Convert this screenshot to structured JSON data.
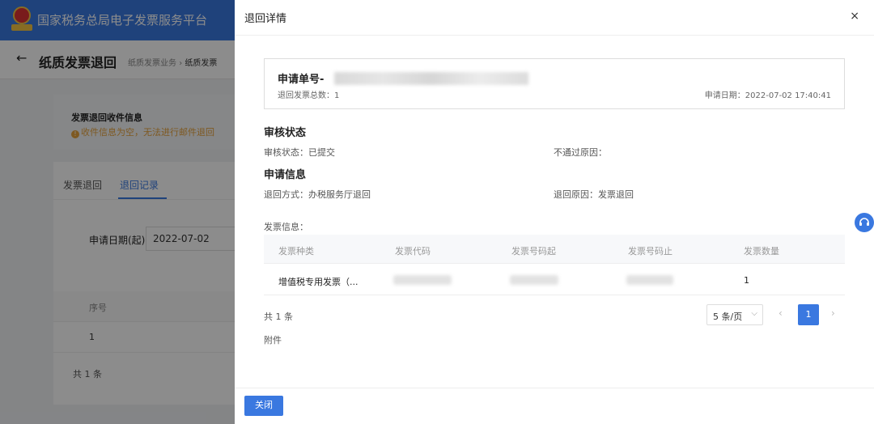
{
  "background": {
    "app_title": "国家税务总局电子发票服务平台",
    "page_title": "纸质发票退回",
    "breadcrumb": [
      "纸质发票业务",
      "纸质发票"
    ],
    "info_card": {
      "heading": "发票退回收件信息",
      "warning": "收件信息为空，无法进行邮件退回"
    },
    "tabs": [
      "发票退回",
      "退回记录"
    ],
    "date_filter": {
      "label": "申请日期(起)",
      "value": "2022-07-02"
    },
    "table": {
      "column": "序号",
      "row_value": "1"
    },
    "total": "共 1 条"
  },
  "drawer": {
    "title": "退回详情",
    "close_glyph": "×",
    "apply_no_label": "申请单号-",
    "apply_total": "退回发票总数：1",
    "apply_date": "申请日期：2022-07-02 17:40:41",
    "review_section": "审核状态",
    "review_status": "审核状态：已提交",
    "reject_reason": "不通过原因：",
    "apply_section": "申请信息",
    "return_method": "退回方式：办税服务厅退回",
    "return_reason": "退回原因：发票退回",
    "invoice_label": "发票信息：",
    "invoice_columns": [
      "发票种类",
      "发票代码",
      "发票号码起",
      "发票号码止",
      "发票数量"
    ],
    "invoice_row": {
      "type": "增值税专用发票（...",
      "quantity": "1"
    },
    "pagination": {
      "total": "共 1 条",
      "page_size": "5 条/页",
      "current": "1"
    },
    "attachment": "附件",
    "close_button": "关闭"
  },
  "colors": {
    "primary": "#3a78e0",
    "warning": "#e6a23c"
  }
}
